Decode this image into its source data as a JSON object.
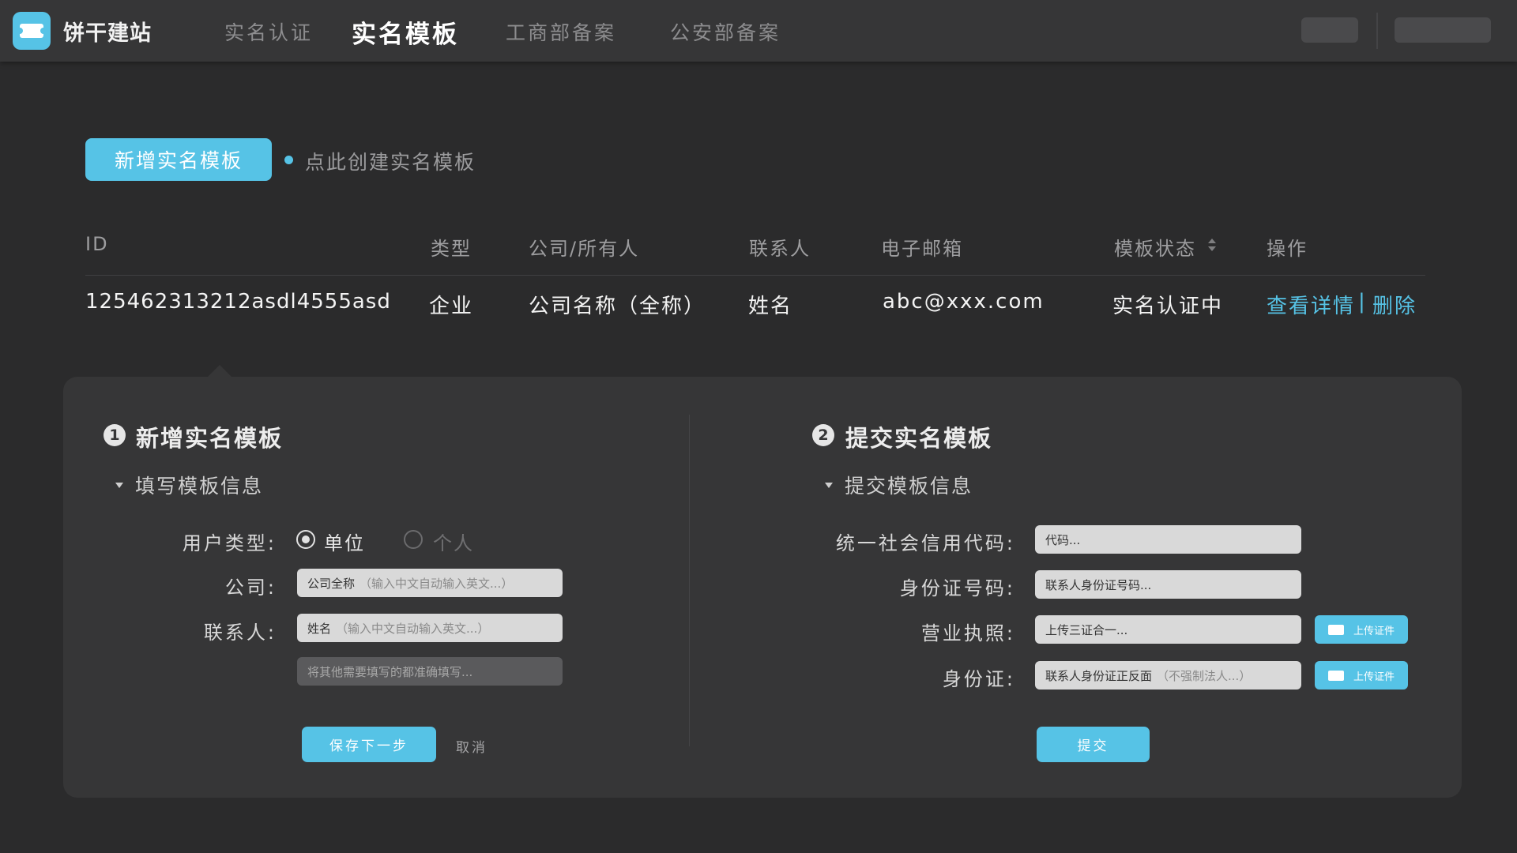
{
  "header": {
    "brand": "饼干建站",
    "nav": [
      {
        "label": "实名认证",
        "active": false
      },
      {
        "label": "实名模板",
        "active": true
      },
      {
        "label": "工商部备案",
        "active": false
      },
      {
        "label": "公安部备案",
        "active": false
      }
    ]
  },
  "toolbar": {
    "add_label": "新增实名模板",
    "hint": "点此创建实名模板"
  },
  "table": {
    "columns": [
      "ID",
      "类型",
      "公司/所有人",
      "联系人",
      "电子邮箱",
      "模板状态",
      "操作"
    ],
    "rows": [
      {
        "id": "125462313212asdl4555asd",
        "type": "企业",
        "company": "公司名称（全称）",
        "contact": "姓名",
        "email": "abc@xxx.com",
        "status": "实名认证中",
        "action_view": "查看详情",
        "action_sep": "|",
        "action_delete": "删除"
      }
    ]
  },
  "step1": {
    "number": "1",
    "title": "新增实名模板",
    "section": "填写模板信息",
    "user_type_label": "用户类型:",
    "radio_unit": "单位",
    "radio_personal": "个人",
    "selected_type": "单位",
    "company_label": "公司:",
    "company_value": "公司全称",
    "company_placeholder": "（输入中文自动输入英文...）",
    "contact_label": "联系人:",
    "contact_value": "姓名",
    "contact_placeholder": "（输入中文自动输入英文...）",
    "other_placeholder": "将其他需要填写的都准确填写...",
    "save_label": "保存下一步",
    "cancel_label": "取消"
  },
  "step2": {
    "number": "2",
    "title": "提交实名模板",
    "section": "提交模板信息",
    "credit_label": "统一社会信用代码:",
    "credit_placeholder": "代码...",
    "idno_label": "身份证号码:",
    "idno_placeholder": "联系人身份证号码...",
    "license_label": "营业执照:",
    "license_placeholder": "上传三证合一...",
    "idcard_label": "身份证:",
    "idcard_value": "联系人身份证正反面",
    "idcard_placeholder": "（不强制法人...）",
    "upload_label": "上传证件",
    "submit_label": "提交"
  },
  "colors": {
    "accent": "#56c3e6",
    "background": "#2b2b2c",
    "panel": "#363637"
  },
  "icons": [
    "logo-ticket-icon",
    "sort-icon",
    "caret-down-icon",
    "upload-ticket-icon"
  ]
}
